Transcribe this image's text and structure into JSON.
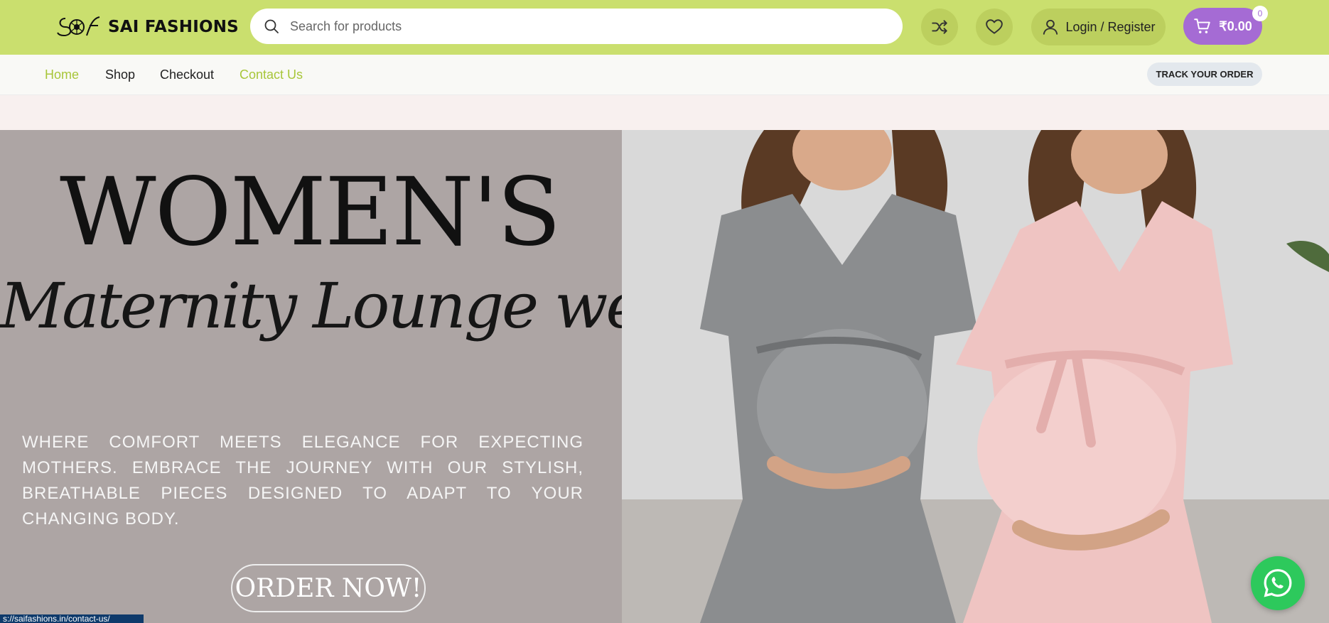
{
  "brand": {
    "name": "SAI FASHIONS",
    "logo_mark": "SF"
  },
  "search": {
    "placeholder": "Search for products",
    "icon": "search-icon"
  },
  "header_actions": {
    "compare_icon": "shuffle-icon",
    "wishlist_icon": "heart-icon",
    "login_label": "Login / Register",
    "cart_total": "₹0.00",
    "cart_count": "0"
  },
  "nav": {
    "items": [
      {
        "label": "Home",
        "active": true
      },
      {
        "label": "Shop",
        "active": false
      },
      {
        "label": "Checkout",
        "active": false
      },
      {
        "label": "Contact Us",
        "active": true
      }
    ],
    "track_label": "TRACK YOUR ORDER"
  },
  "hero": {
    "headline": "WOMEN'S",
    "script": "Maternity Lounge wears",
    "tagline": "WHERE COMFORT MEETS ELEGANCE FOR EXPECTING MOTHERS. EMBRACE THE JOURNEY WITH OUR STYLISH, BREATHABLE PIECES DESIGNED TO ADAPT TO YOUR CHANGING BODY.",
    "cta": "ORDER NOW!"
  },
  "status_url": "s://saifashions.in/contact-us/",
  "colors": {
    "accent": "#cadf6e",
    "cart": "#a56bd4",
    "whatsapp": "#2dc95c",
    "hero_left": "#ada5a4"
  }
}
